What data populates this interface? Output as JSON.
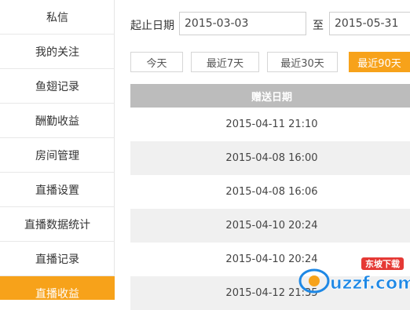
{
  "sidebar": {
    "items": [
      {
        "label": "私信"
      },
      {
        "label": "我的关注"
      },
      {
        "label": "鱼翅记录"
      },
      {
        "label": "酬勤收益"
      },
      {
        "label": "房间管理"
      },
      {
        "label": "直播设置"
      },
      {
        "label": "直播数据统计"
      },
      {
        "label": "直播记录"
      },
      {
        "label": "直播收益",
        "active": true
      }
    ]
  },
  "filter": {
    "label": "起止日期",
    "start_date": "2015-03-03",
    "to_label": "至",
    "end_date": "2015-05-31"
  },
  "quick_ranges": [
    {
      "label": "今天"
    },
    {
      "label": "最近7天"
    },
    {
      "label": "最近30天"
    },
    {
      "label": "最近90天",
      "active": true
    }
  ],
  "table": {
    "header": "赠送日期",
    "rows": [
      "2015-04-11 21:10",
      "2015-04-08 16:00",
      "2015-04-08 16:06",
      "2015-04-10 20:24",
      "2015-04-10 20:24",
      "2015-04-12 21:35"
    ]
  },
  "watermark": {
    "brand_text": "uzzf.com",
    "cn_text": "东坡下载"
  },
  "colors": {
    "accent": "#f7a21a",
    "table_header": "#bcbcbc",
    "row_alt": "#f0f0f0"
  }
}
